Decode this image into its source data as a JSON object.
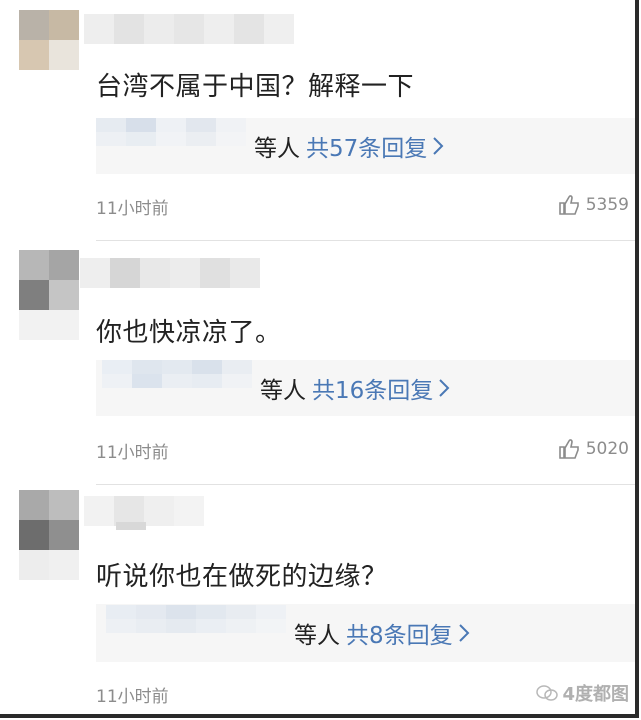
{
  "comments": [
    {
      "text": "台湾不属于中国？解释一下",
      "reply_who": "等人",
      "reply_link": "共57条回复",
      "time": "11小时前",
      "likes": "5359"
    },
    {
      "text": "你也快凉凉了。",
      "reply_who": "等人",
      "reply_link": "共16条回复",
      "time": "11小时前",
      "likes": "5020"
    },
    {
      "text": "听说你也在做死的边缘？",
      "reply_who": "等人",
      "reply_link": "共8条回复",
      "time": "11小时前",
      "likes": ""
    }
  ],
  "colors": {
    "link": "#4a78b5",
    "meta": "#8c8c8c",
    "text": "#222222"
  },
  "icons": {
    "like": "thumbs-up-icon",
    "chevron": "chevron-right-icon"
  },
  "watermark": {
    "text": "4度都图"
  }
}
